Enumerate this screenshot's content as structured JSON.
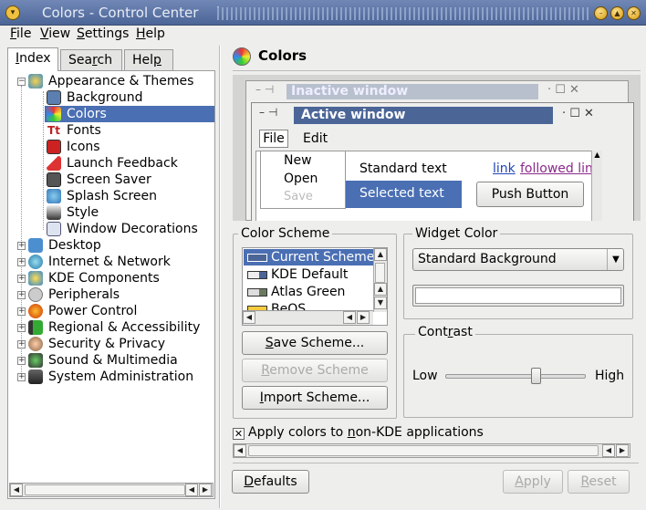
{
  "window": {
    "title": "Colors - Control Center"
  },
  "menubar": [
    {
      "key": "F",
      "rest": "ile"
    },
    {
      "key": "V",
      "rest": "iew"
    },
    {
      "key": "S",
      "rest": "ettings"
    },
    {
      "key": "H",
      "rest": "elp"
    }
  ],
  "tabs": [
    {
      "key": "I",
      "rest": "ndex"
    },
    {
      "pre": "Sea",
      "key": "r",
      "rest": "ch"
    },
    {
      "pre": "Hel",
      "key": "p",
      "rest": ""
    }
  ],
  "tree": {
    "appearance": "Appearance & Themes",
    "children": [
      "Background",
      "Colors",
      "Fonts",
      "Icons",
      "Launch Feedback",
      "Screen Saver",
      "Splash Screen",
      "Style",
      "Window Decorations"
    ],
    "selected": "Colors",
    "categories": [
      "Desktop",
      "Internet & Network",
      "KDE Components",
      "Peripherals",
      "Power Control",
      "Regional & Accessibility",
      "Security & Privacy",
      "Sound & Multimedia",
      "System Administration"
    ]
  },
  "header": {
    "title": "Colors"
  },
  "preview": {
    "inactive": "Inactive window",
    "active": "Active window",
    "menu_file": "File",
    "menu_edit": "Edit",
    "menu_items": [
      "New",
      "Open",
      "Save"
    ],
    "standard_text": "Standard text",
    "selected_text": "Selected text",
    "link": "link",
    "followed_link": "followed link",
    "push_button": "Push Button"
  },
  "color_scheme": {
    "label": "Color Scheme",
    "items": [
      "Current Scheme",
      "KDE Default",
      "Atlas Green",
      "BeOS"
    ],
    "save": {
      "pre": "",
      "key": "S",
      "rest": "ave Scheme..."
    },
    "remove": {
      "pre": "",
      "key": "R",
      "rest": "emove Scheme"
    },
    "import": {
      "pre": "",
      "key": "I",
      "rest": "mport Scheme..."
    }
  },
  "widget_color": {
    "label": "Widget Color",
    "selected": "Standard Background"
  },
  "contrast": {
    "label": "Contrast",
    "pre": "Cont",
    "key": "r",
    "rest": "ast",
    "low": "Low",
    "high": "High",
    "level": 0.65
  },
  "apply_nonkde": {
    "pre": "Apply colors to ",
    "key": "n",
    "rest": "on-KDE applications",
    "checked": true
  },
  "buttons": {
    "defaults": {
      "key": "D",
      "rest": "efaults"
    },
    "apply": {
      "key": "A",
      "rest": "pply"
    },
    "reset": {
      "key": "R",
      "rest": "eset"
    }
  },
  "colors": {
    "titlebar": "#4b6597",
    "selection": "#4a6fb3",
    "inactive": "#b8c0ce"
  }
}
